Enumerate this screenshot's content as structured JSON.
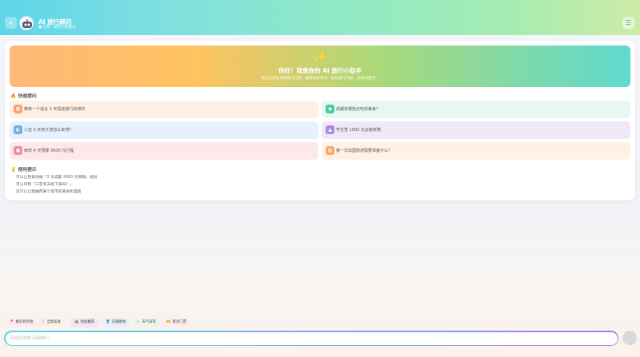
{
  "header": {
    "title": "AI 旅行顾问",
    "subtitle": "● 在线 · 随时为您服务",
    "back_icon": "chevron-left-icon",
    "menu_icon": "menu-icon"
  },
  "hero": {
    "icon": "sparkle-icon",
    "title": "你好！我是你的 AI 旅行小助手",
    "subtitle": "我可以帮你规划旅行行程、推荐美食景点、解答旅行问题，快来问我吧～"
  },
  "quick": {
    "title": "快速提问",
    "items": [
      {
        "label": "推荐一个适合 3 天短途旅行的城市",
        "icon": "map-icon",
        "bg": "#fff1e6",
        "ic": "#ff9f6b"
      },
      {
        "label": "成都有哪些必吃的美食？",
        "icon": "food-icon",
        "bg": "#e6f8f1",
        "ic": "#4ccaa0"
      },
      {
        "label": "三亚 5 天亲子游怎么安排？",
        "icon": "beach-icon",
        "bg": "#e6f1fb",
        "ic": "#6fb0e8"
      },
      {
        "label": "学生党 1000 元云南攻略",
        "icon": "student-icon",
        "bg": "#efe8f8",
        "ic": "#a88ad8"
      },
      {
        "label": "西安 4 天预算 3000 元行程",
        "icon": "calendar-icon",
        "bg": "#fde8ec",
        "ic": "#f08aa0"
      },
      {
        "label": "第一次出国旅游需要准备什么？",
        "icon": "passport-icon",
        "bg": "#fff1e4",
        "ic": "#f5a86a"
      }
    ]
  },
  "tips": {
    "title": "使用提示",
    "lines": [
      "可以让我帮你做「3 天成都 2000 元预算」规划",
      "可以问我「三亚冬天能下海吗？」",
      "还可以让我推荐某个城市的美食和酒店"
    ]
  },
  "chips": [
    {
      "label": "推荐目的地",
      "icon": "📍",
      "bg": "#fdecef"
    },
    {
      "label": "当地美食",
      "icon": "🍴",
      "bg": "#fdf0e6"
    },
    {
      "label": "住宿推荐",
      "icon": "🏨",
      "bg": "#efe6f8"
    },
    {
      "label": "交通路线",
      "icon": "🚆",
      "bg": "#e6f1fb"
    },
    {
      "label": "天气穿衣",
      "icon": "⛅",
      "bg": "#e9f8ec"
    },
    {
      "label": "景点门票",
      "icon": "🎫",
      "bg": "#fdecec"
    }
  ],
  "input": {
    "placeholder": "问我任何旅行问题吧～"
  }
}
